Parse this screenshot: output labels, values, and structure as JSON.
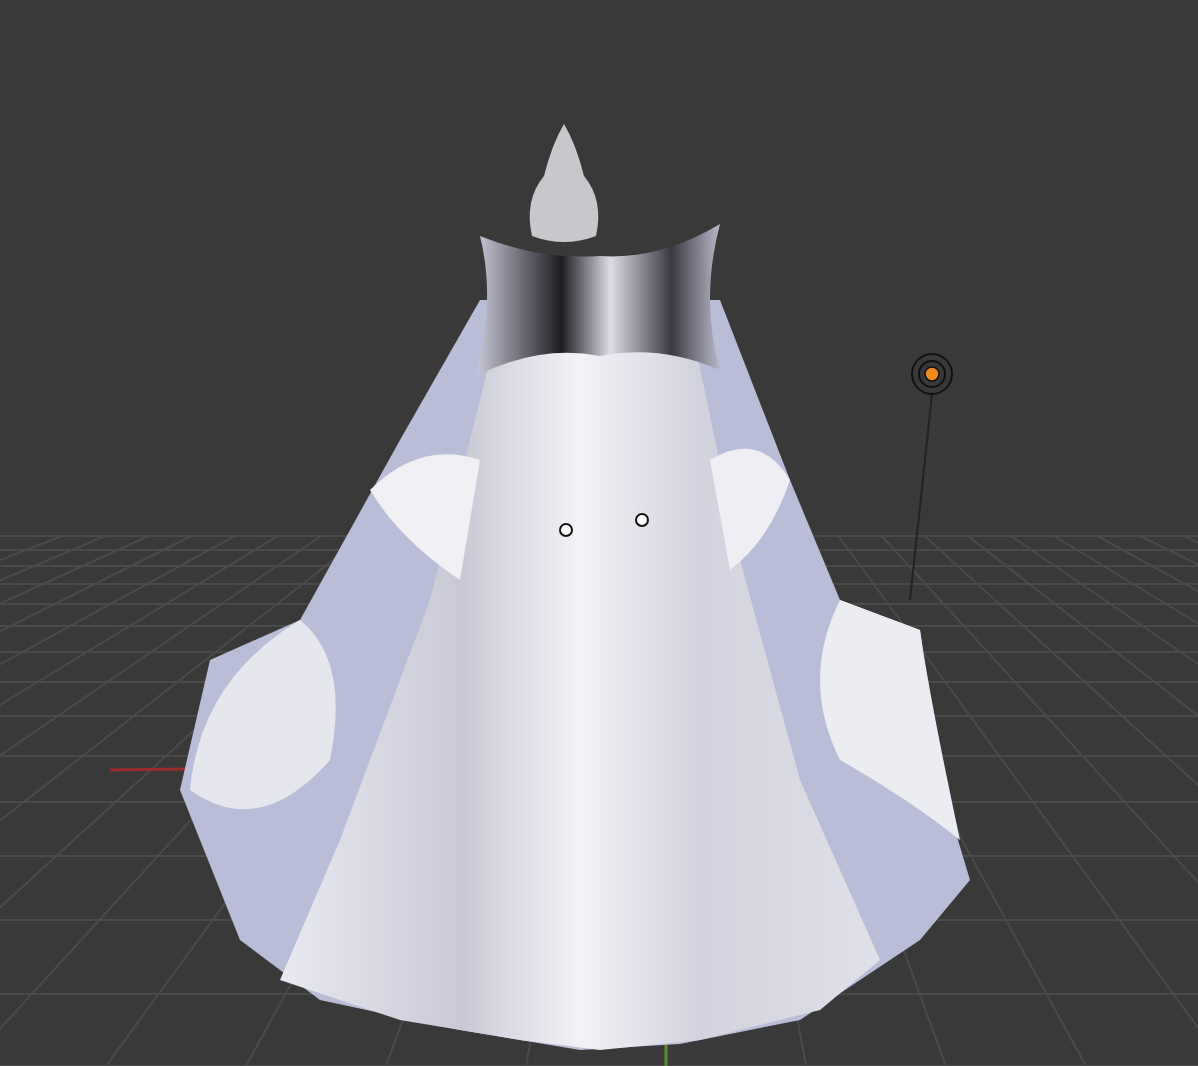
{
  "viewport": {
    "objects": [
      {
        "kind": "grid"
      },
      {
        "kind": "mesh"
      },
      {
        "kind": "lamp"
      }
    ]
  }
}
